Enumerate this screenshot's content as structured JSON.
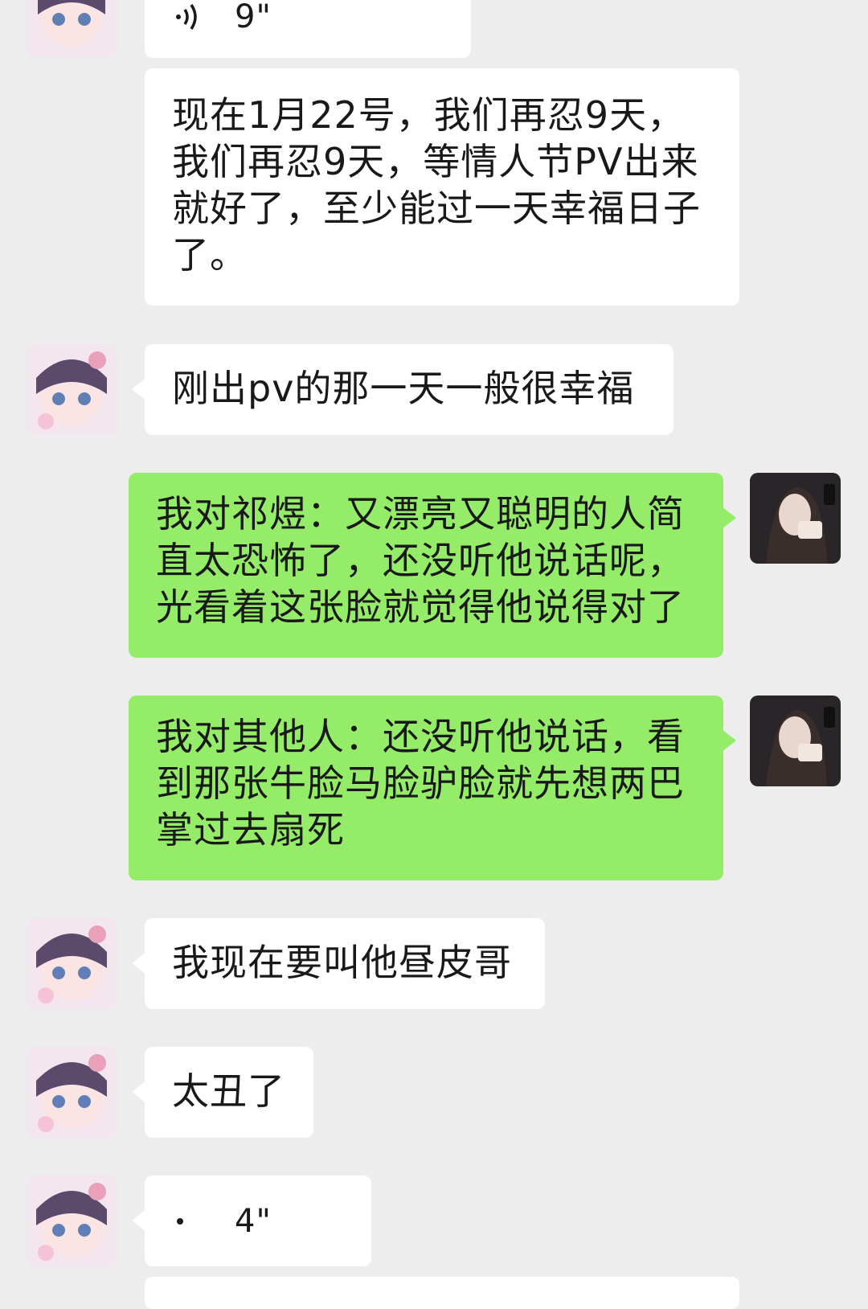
{
  "messages": [
    {
      "type": "voice",
      "side": "in",
      "duration": "9\""
    },
    {
      "type": "text",
      "side": "in",
      "text": "现在1月22号，我们再忍9天，我们再忍9天，等情人节PV出来就好了，至少能过一天幸福日子了。"
    },
    {
      "type": "text",
      "side": "in",
      "text": "刚出pv的那一天一般很幸福"
    },
    {
      "type": "text",
      "side": "out",
      "text": "我对祁煜：又漂亮又聪明的人简直太恐怖了，还没听他说话呢，光看着这张脸就觉得他说得对了"
    },
    {
      "type": "text",
      "side": "out",
      "text": "我对其他人：还没听他说话，看到那张牛脸马脸驴脸就先想两巴掌过去扇死"
    },
    {
      "type": "text",
      "side": "in",
      "text": "我现在要叫他昼皮哥"
    },
    {
      "type": "text",
      "side": "in",
      "text": "太丑了"
    },
    {
      "type": "voice",
      "side": "in",
      "duration": "4\""
    }
  ],
  "colors": {
    "background": "#ededed",
    "incoming_bubble": "#ffffff",
    "outgoing_bubble": "#95ec69",
    "text": "#191919"
  },
  "icons": {
    "voice": "voice-wave-icon",
    "avatar_in": "anime-doll-avatar",
    "avatar_out": "girl-selfie-avatar"
  }
}
